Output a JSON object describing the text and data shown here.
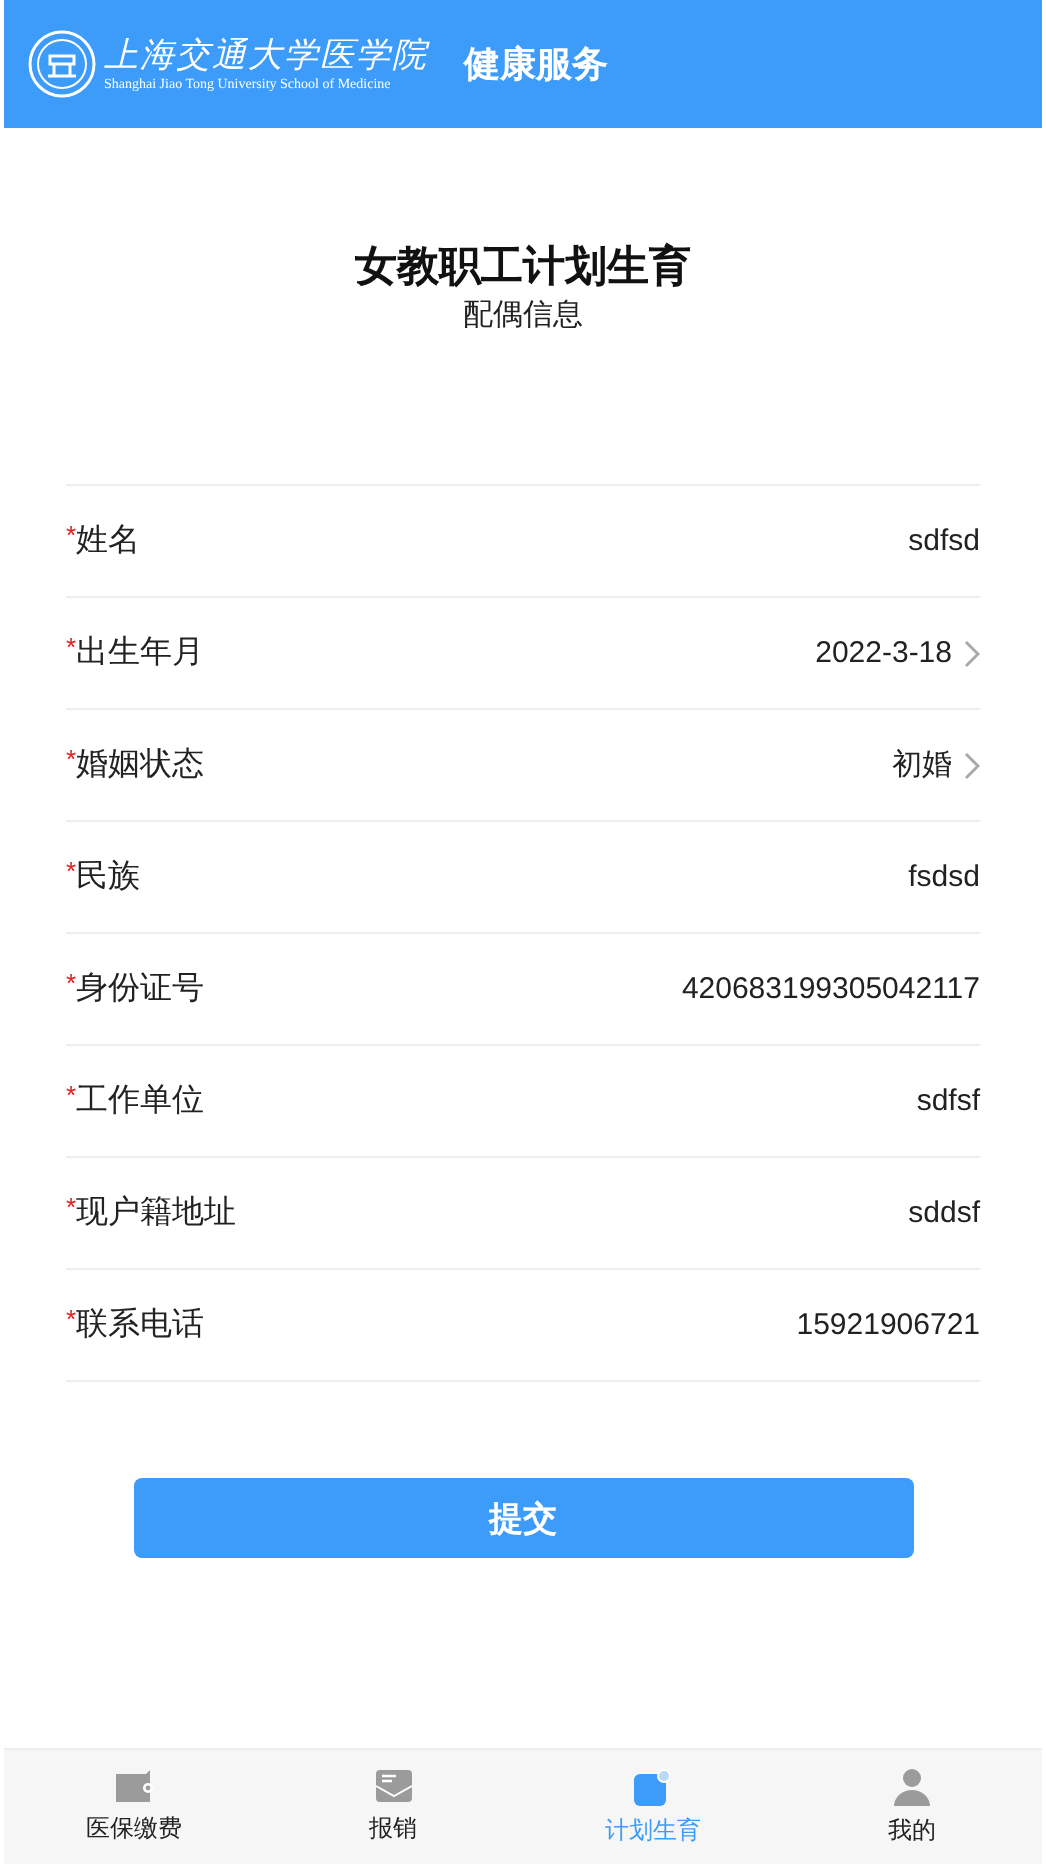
{
  "header": {
    "logo_name": "上海交通大学医学院",
    "logo_subtitle": "Shanghai Jiao Tong University School of Medicine",
    "title": "健康服务"
  },
  "page": {
    "title": "女教职工计划生育",
    "subtitle": "配偶信息"
  },
  "fields": [
    {
      "label": "姓名",
      "required_mark": "*",
      "value": "sdfsd",
      "kind": "text"
    },
    {
      "label": "出生年月",
      "required_mark": "*",
      "value": "2022-3-18",
      "kind": "picker"
    },
    {
      "label": "婚姻状态",
      "required_mark": "*",
      "value": "初婚",
      "kind": "picker"
    },
    {
      "label": "民族",
      "required_mark": "*",
      "value": "fsdsd",
      "kind": "text"
    },
    {
      "label": "身份证号",
      "required_mark": "*",
      "value": "420683199305042117",
      "kind": "text"
    },
    {
      "label": "工作单位",
      "required_mark": "*",
      "value": "sdfsf",
      "kind": "text"
    },
    {
      "label": "现户籍地址",
      "required_mark": "*",
      "value": "sddsf",
      "kind": "text"
    },
    {
      "label": "联系电话",
      "required_mark": "*",
      "value": "15921906721",
      "kind": "text"
    }
  ],
  "submit": "提交",
  "tabs": [
    {
      "label": "医保缴费",
      "kind": "wallet",
      "selected": false
    },
    {
      "label": "报销",
      "kind": "mail",
      "selected": false
    },
    {
      "label": "计划生育",
      "kind": "note",
      "selected": true
    },
    {
      "label": "我的",
      "kind": "person",
      "selected": false
    }
  ]
}
